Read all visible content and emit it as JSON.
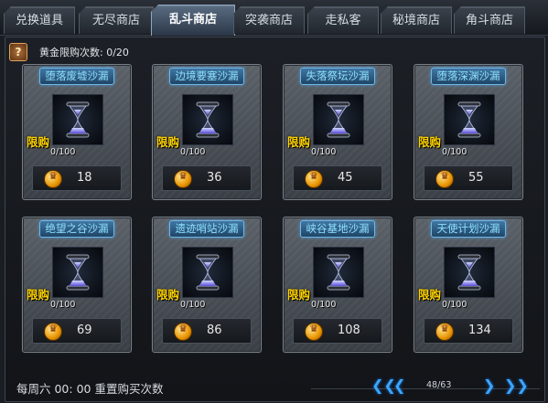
{
  "tabs": [
    {
      "label": "兑换道具",
      "active": false
    },
    {
      "label": "无尽商店",
      "active": false
    },
    {
      "label": "乱斗商店",
      "active": true
    },
    {
      "label": "突袭商店",
      "active": false
    },
    {
      "label": "走私客",
      "active": false
    },
    {
      "label": "秘境商店",
      "active": false
    },
    {
      "label": "角斗商店",
      "active": false
    }
  ],
  "quota": {
    "icon": "help-icon",
    "text": "黄金限购次数: 0/20"
  },
  "limit_badge": "限购",
  "items": [
    {
      "name": "堕落废墟沙漏",
      "count": "0/100",
      "price": "18"
    },
    {
      "name": "边境要塞沙漏",
      "count": "0/100",
      "price": "36"
    },
    {
      "name": "失落祭坛沙漏",
      "count": "0/100",
      "price": "45"
    },
    {
      "name": "堕落深渊沙漏",
      "count": "0/100",
      "price": "55"
    },
    {
      "name": "绝望之谷沙漏",
      "count": "0/100",
      "price": "69"
    },
    {
      "name": "遗迹哨站沙漏",
      "count": "0/100",
      "price": "86"
    },
    {
      "name": "峡谷基地沙漏",
      "count": "0/100",
      "price": "108"
    },
    {
      "name": "天使计划沙漏",
      "count": "0/100",
      "price": "134"
    }
  ],
  "footer": {
    "reset_text": "每周六 00: 00 重置购买次数",
    "first_page": "❮❮",
    "prev_page": "❮",
    "page_indicator": "48/63",
    "next_page": "❯",
    "last_page": "❯❯"
  },
  "colors": {
    "accent": "#3aa6ff",
    "limit": "#ffd400",
    "item_name": "#8fe0ff"
  }
}
